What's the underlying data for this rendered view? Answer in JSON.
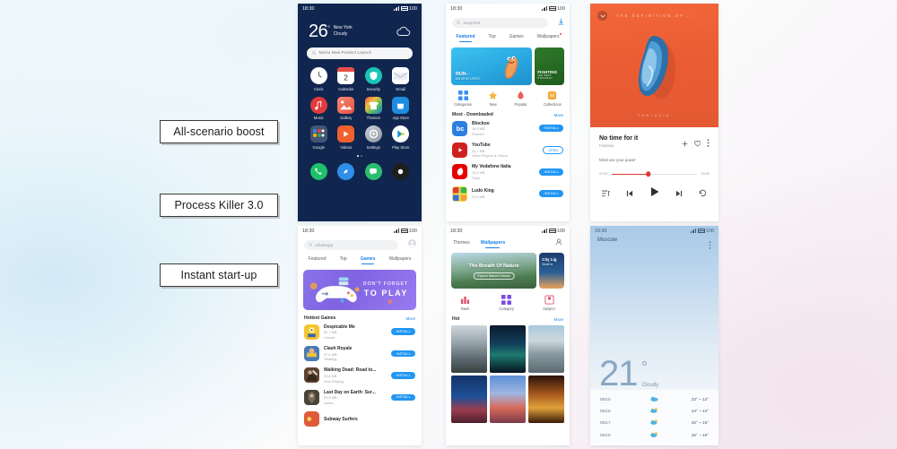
{
  "callouts": [
    {
      "label": "All-scenario boost"
    },
    {
      "label": "Process Killer 3.0"
    },
    {
      "label": "Instant start-up"
    }
  ],
  "status_bar": {
    "time": "18:30",
    "battery": "100"
  },
  "home_screen": {
    "temperature": "26",
    "degree": "°",
    "city": "New York",
    "condition": "Cloudy",
    "search_placeholder": "Meizu New Product Launch",
    "search_icon": "search-icon",
    "weather_icon": "cloud-icon",
    "apps": [
      {
        "label": "Clock",
        "icon": "clock-icon"
      },
      {
        "label": "Calendar",
        "icon": "calendar-icon"
      },
      {
        "label": "Security",
        "icon": "shield-icon"
      },
      {
        "label": "Email",
        "icon": "envelope-icon"
      },
      {
        "label": "Music",
        "icon": "music-note-icon"
      },
      {
        "label": "Gallery",
        "icon": "photo-icon"
      },
      {
        "label": "Themes",
        "icon": "tshirt-icon"
      },
      {
        "label": "App Store",
        "icon": "shopping-bag-icon"
      },
      {
        "label": "Google",
        "icon": "google-folder-icon"
      },
      {
        "label": "Videos",
        "icon": "play-triangle-icon"
      },
      {
        "label": "Settings",
        "icon": "gear-icon"
      },
      {
        "label": "Play Store",
        "icon": "play-store-icon"
      }
    ],
    "dock": [
      {
        "name": "phone-icon"
      },
      {
        "name": "browser-icon"
      },
      {
        "name": "messages-icon"
      },
      {
        "name": "camera-icon"
      }
    ]
  },
  "app_store": {
    "search_value": "snapchat",
    "search_icon": "search-icon",
    "header_icon": "download-icon",
    "tabs": [
      {
        "label": "Featured",
        "active": true
      },
      {
        "label": "Top",
        "active": false
      },
      {
        "label": "Games",
        "active": false
      },
      {
        "label": "Wallpapers",
        "active": false,
        "badge": true
      }
    ],
    "banners": [
      {
        "title": "RUN -",
        "subtitle": "ADVENTURES"
      },
      {
        "title": "FIGHTING",
        "subtitle": "THE BEST STRATEGY"
      }
    ],
    "quick_links": [
      {
        "label": "Categories",
        "icon": "grid-icon"
      },
      {
        "label": "New",
        "icon": "new-icon"
      },
      {
        "label": "Popular",
        "icon": "fire-icon"
      },
      {
        "label": "Collections",
        "icon": "collections-icon"
      }
    ],
    "section": {
      "title": "Most - Downloaded",
      "more": "More"
    },
    "apps": [
      {
        "name": "Blockoo",
        "size": "18.5 MB",
        "category": "Finance",
        "action": "INSTALL",
        "action_type": "install"
      },
      {
        "name": "YouTube",
        "size": "24.7 MB",
        "category": "Video Players & Others",
        "action": "OPEN",
        "action_type": "open"
      },
      {
        "name": "My Vodafone Italia",
        "size": "13.3 MB",
        "category": "Tools",
        "action": "INSTALL",
        "action_type": "install"
      },
      {
        "name": "Ludo King",
        "size": "21.6 MB",
        "category": "Board",
        "action": "INSTALL",
        "action_type": "install"
      }
    ]
  },
  "games_store": {
    "search_value": "whatsapp",
    "search_icon": "search-icon",
    "avatar_icon": "user-avatar-icon",
    "tabs": [
      {
        "label": "Featured",
        "active": false
      },
      {
        "label": "Top",
        "active": false
      },
      {
        "label": "Games",
        "active": true
      },
      {
        "label": "Wallpapers",
        "active": false
      }
    ],
    "banner": {
      "line1": "DON'T FORGET",
      "line2": "TO PLAY"
    },
    "section": {
      "title": "Hottest Games",
      "more": "More"
    },
    "apps": [
      {
        "name": "Despicable Me",
        "size": "82.7 MB",
        "category": "Casual",
        "action": "INSTALL"
      },
      {
        "name": "Clash Royale",
        "size": "97.6 MB",
        "category": "Strategy",
        "action": "INSTALL"
      },
      {
        "name": "Walking Dead: Road to...",
        "size": "33.8 MB",
        "category": "Role Playing",
        "action": "INSTALL"
      },
      {
        "name": "Last Day on Earth: Sur...",
        "size": "93.6 MB",
        "category": "Action",
        "action": "INSTALL"
      },
      {
        "name": "Subway Surfers",
        "size": "",
        "category": "",
        "action": ""
      }
    ]
  },
  "wallpapers": {
    "tabs": [
      {
        "label": "Themes",
        "active": false
      },
      {
        "label": "Wallpapers",
        "active": true
      }
    ],
    "account_icon": "user-account-icon",
    "banner_main": {
      "title": "The Breath Of Nature",
      "subtitle": "Explore Nature's Beauty"
    },
    "banner_side": {
      "title": "City Lig",
      "subtitle": "Small w"
    },
    "quick_links": [
      {
        "label": "Rank",
        "icon": "bar-chart-icon"
      },
      {
        "label": "Category",
        "icon": "grid-squares-icon"
      },
      {
        "label": "Subject",
        "icon": "bookmark-icon"
      }
    ],
    "section": {
      "title": "Hot",
      "more": "More"
    },
    "grid": [
      {
        "name": "forest-snow-wallpaper"
      },
      {
        "name": "aurora-wallpaper"
      },
      {
        "name": "city-skyline-wallpaper"
      },
      {
        "name": "saint-basil-wallpaper"
      },
      {
        "name": "sunset-clouds-wallpaper"
      },
      {
        "name": "fireworks-wallpaper"
      }
    ]
  },
  "music_player": {
    "album_title": "THE DEFINITION OF...",
    "album_subtitle": "FANTASIA",
    "collapse_icon": "chevron-down-icon",
    "song_title": "No time for it",
    "artist": "Fantasia",
    "lyric": "Mind use your power",
    "actions": [
      {
        "icon": "plus-icon"
      },
      {
        "icon": "heart-icon"
      },
      {
        "icon": "more-vertical-icon"
      }
    ],
    "elapsed": "01:30",
    "duration": "03:30",
    "progress_percent": 43,
    "controls": [
      {
        "icon": "playlist-icon"
      },
      {
        "icon": "previous-icon"
      },
      {
        "icon": "play-icon"
      },
      {
        "icon": "next-icon"
      },
      {
        "icon": "repeat-icon"
      }
    ]
  },
  "weather": {
    "city": "Moscow",
    "menu_icon": "more-vertical-icon",
    "temperature": "21",
    "condition": "Cloudy",
    "forecast": [
      {
        "date": "05/15",
        "icon": "cloud-icon",
        "temps": "23° ~ 12°"
      },
      {
        "date": "05/16",
        "icon": "partly-cloudy-icon",
        "temps": "24° ~ 14°"
      },
      {
        "date": "05/17",
        "icon": "partly-cloudy-icon",
        "temps": "26° ~ 16°"
      },
      {
        "date": "05/18",
        "icon": "partly-cloudy-icon",
        "temps": "25° ~ 19°"
      }
    ]
  },
  "colors": {
    "accent_blue": "#2196f3",
    "home_bg": "#10264f",
    "album_orange": "#ea5c33",
    "player_red": "#d83a2e"
  }
}
